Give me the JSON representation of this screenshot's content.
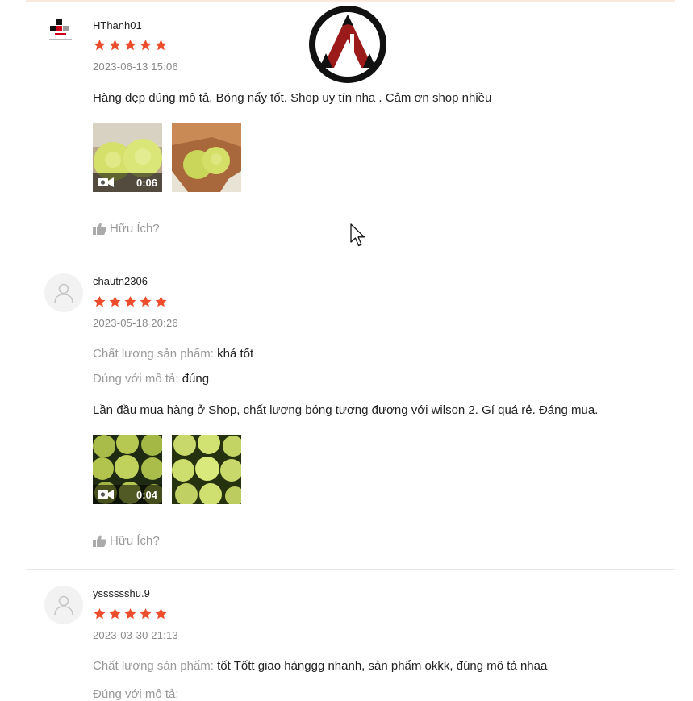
{
  "reviews": [
    {
      "username": "HThanh01",
      "rating": 5,
      "date": "2023-06-13 15:06",
      "comment": "Hàng đẹp đúng mô tả. Bóng nẩy tốt. Shop uy tín nha . Cảm ơn shop nhiều",
      "video_duration": "0:06",
      "helpful_label": "Hữu Ích?"
    },
    {
      "username": "chautn2306",
      "rating": 5,
      "date": "2023-05-18 20:26",
      "quality_label": "Chất lượng sản phẩm:",
      "quality_value": "khá tốt",
      "match_label": "Đúng với mô tả:",
      "match_value": "đúng",
      "comment": "Lần đầu mua hàng ở Shop, chất lượng bóng tương đương với wilson 2. Gí quá rẻ. Đáng mua.",
      "video_duration": "0:04",
      "helpful_label": "Hữu Ích?"
    },
    {
      "username": "ysssssshu.9",
      "rating": 5,
      "date": "2023-03-30 21:13",
      "quality_label": "Chất lượng sản phẩm:",
      "quality_value": "tốt Tốtt giao hànggg nhanh, sản phẩm okkk, đúng mô tả nhaa",
      "match_label": "Đúng với mô tả:"
    }
  ],
  "colors": {
    "star": "#ee4d2d",
    "divider": "#e8e8e8",
    "muted_text": "#999999",
    "watermark_red": "#9b1b1b"
  },
  "icons": [
    "star-icon",
    "video-icon",
    "thumbs-up-icon",
    "user-avatar-icon",
    "mouse-cursor-icon"
  ]
}
